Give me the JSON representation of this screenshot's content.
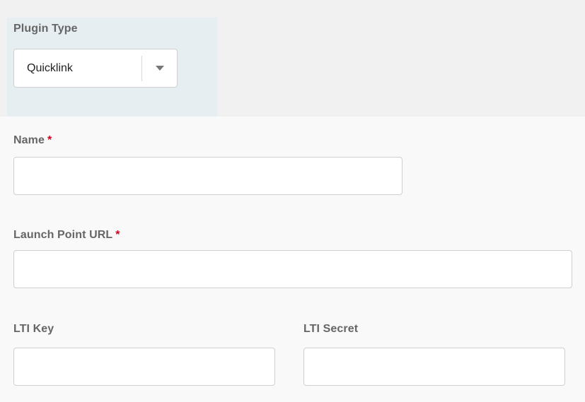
{
  "plugin_type": {
    "label": "Plugin Type",
    "selected": "Quicklink"
  },
  "name_field": {
    "label": "Name",
    "required_marker": "*",
    "value": ""
  },
  "launch_url_field": {
    "label": "Launch Point URL",
    "required_marker": "*",
    "value": ""
  },
  "lti_key_field": {
    "label": "LTI Key",
    "value": ""
  },
  "lti_secret_field": {
    "label": "LTI Secret",
    "value": ""
  },
  "colors": {
    "required_marker": "#d0021b",
    "plugin_panel_bg": "#e6eef2",
    "label_text": "#666666"
  },
  "icons": {
    "select_arrow": "chevron-down-icon"
  }
}
